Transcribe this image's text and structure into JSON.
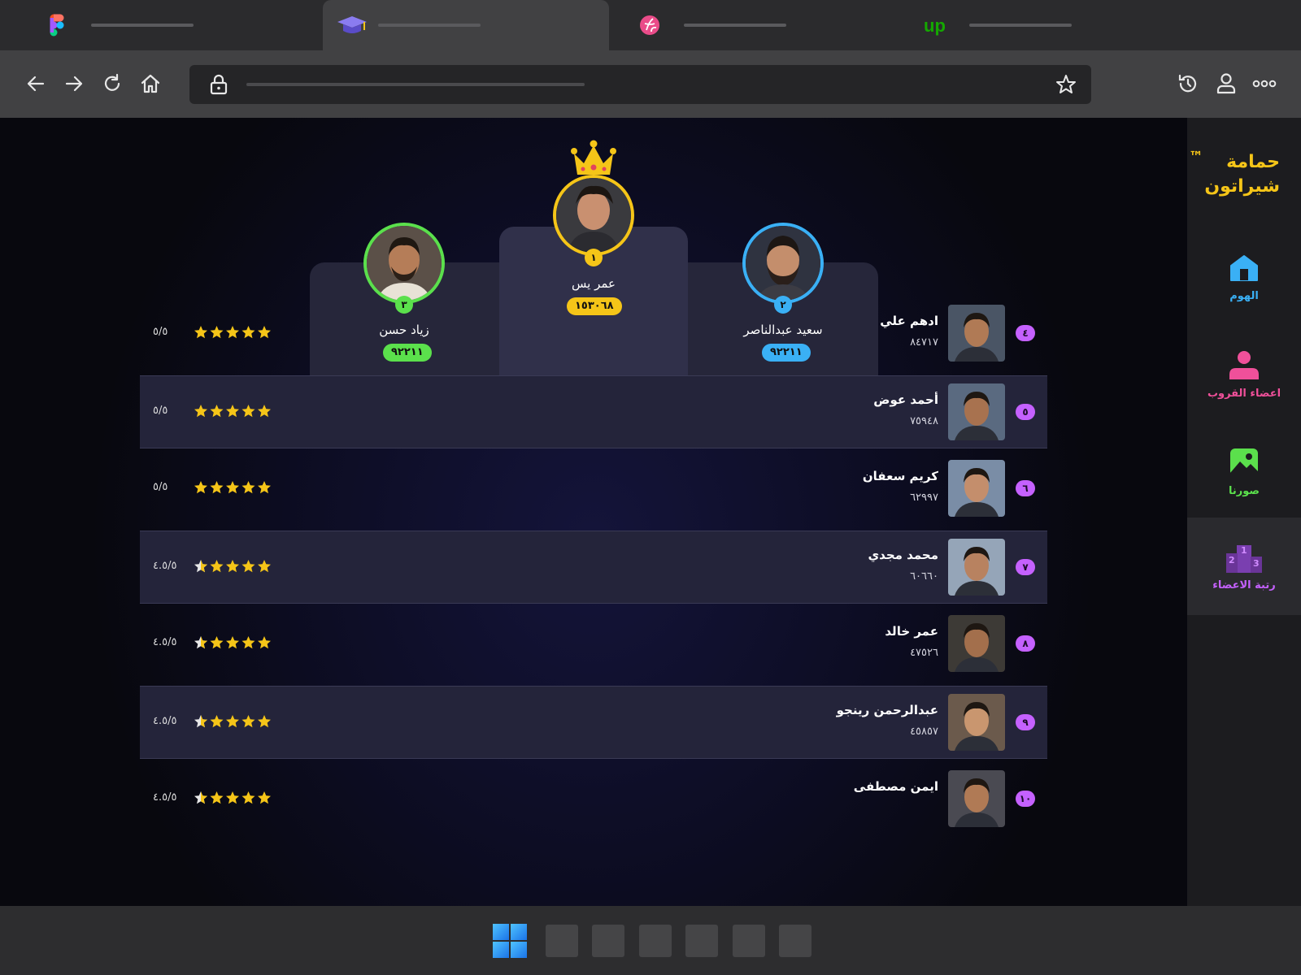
{
  "browser": {
    "tabs": [
      {
        "icon": "figma-icon",
        "active": false
      },
      {
        "icon": "graduation-cap-icon",
        "active": true
      },
      {
        "icon": "dribbble-icon",
        "active": false
      },
      {
        "icon": "upwork-icon",
        "active": false
      }
    ],
    "toolbar_icons": [
      "back-arrow-icon",
      "forward-arrow-icon",
      "reload-icon",
      "home-icon",
      "lock-icon",
      "bookmark-star-icon",
      "history-icon",
      "profile-icon",
      "more-options-icon"
    ]
  },
  "sidebar": {
    "brand_line1": "حمامة",
    "brand_line2": "شيراتون",
    "brand_tm": "™",
    "items": [
      {
        "label": "الهوم",
        "icon": "home-icon",
        "color": "#3ab0f5"
      },
      {
        "label": "اعضاء القروب",
        "icon": "members-icon",
        "color": "#f0509a"
      },
      {
        "label": "صورنا",
        "icon": "photos-icon",
        "color": "#5be04c"
      },
      {
        "label": "رتبة الاعضاء",
        "icon": "ranking-podium-icon",
        "color": "#b34ff0",
        "active": true
      }
    ]
  },
  "podium": {
    "first": {
      "rank": "١",
      "name": "عمر يس",
      "score": "١٥٣٠٦٨",
      "color": "#f5c518"
    },
    "second": {
      "rank": "٢",
      "name": "سعيد عبدالناصر",
      "score": "٩٢٢١١",
      "color": "#3ab0f5"
    },
    "third": {
      "rank": "٣",
      "name": "زياد حسن",
      "score": "٩٢٢١١",
      "color": "#5be04c"
    }
  },
  "leaderboard": [
    {
      "rank": "٤",
      "name": "ادهم علي",
      "score": "٨٤٧١٧",
      "rating": "٥/٥",
      "stars": 5
    },
    {
      "rank": "٥",
      "name": "أحمد عوض",
      "score": "٧٥٩٤٨",
      "rating": "٥/٥",
      "stars": 5
    },
    {
      "rank": "٦",
      "name": "كريم سعفان",
      "score": "٦٢٩٩٧",
      "rating": "٥/٥",
      "stars": 5
    },
    {
      "rank": "٧",
      "name": "محمد مجدي",
      "score": "٦٠٦٦٠",
      "rating": "٤.٥/٥",
      "stars": 4.5
    },
    {
      "rank": "٨",
      "name": "عمر خالد",
      "score": "٤٧٥٢٦",
      "rating": "٤.٥/٥",
      "stars": 4.5
    },
    {
      "rank": "٩",
      "name": "عبدالرحمن رينجو",
      "score": "٤٥٨٥٧",
      "rating": "٤.٥/٥",
      "stars": 4.5
    },
    {
      "rank": "١٠",
      "name": "ايمن مصطفى",
      "score": "",
      "rating": "٤.٥/٥",
      "stars": 4.5
    }
  ],
  "colors": {
    "accent_purple": "#c561ff",
    "star": "#f5c518"
  }
}
